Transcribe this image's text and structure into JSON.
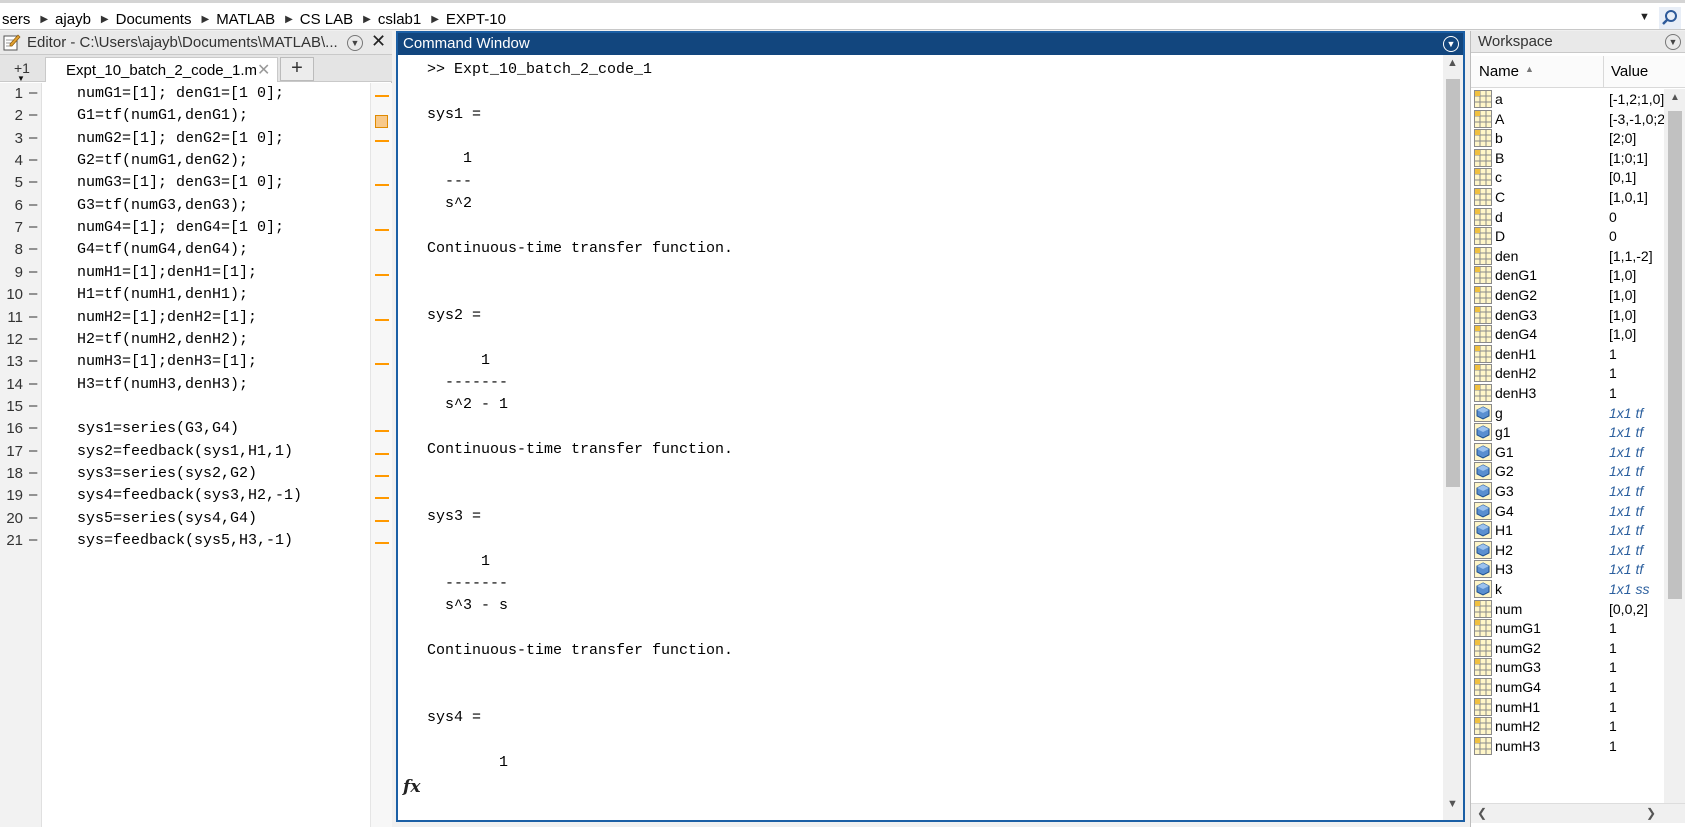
{
  "address_bar": {
    "crumbs": [
      "sers",
      "ajayb",
      "Documents",
      "MATLAB",
      "CS LAB",
      "cslab1",
      "EXPT-10"
    ]
  },
  "editor": {
    "title": "Editor - C:\\Users\\ajayb\\Documents\\MATLAB\\...",
    "split_label": "+1",
    "tab_label": "Expt_10_batch_2_code_1.m",
    "new_tab_symbol": "+",
    "lines": [
      {
        "n": "1",
        "text": "numG1=[1]; denG1=[1 0];",
        "warn": true
      },
      {
        "n": "2",
        "text": "G1=tf(numG1,denG1);",
        "warn": false
      },
      {
        "n": "3",
        "text": "numG2=[1]; denG2=[1 0];",
        "warn": true
      },
      {
        "n": "4",
        "text": "G2=tf(numG1,denG2);",
        "warn": false
      },
      {
        "n": "5",
        "text": "numG3=[1]; denG3=[1 0];",
        "warn": true
      },
      {
        "n": "6",
        "text": "G3=tf(numG3,denG3);",
        "warn": false
      },
      {
        "n": "7",
        "text": "numG4=[1]; denG4=[1 0];",
        "warn": true
      },
      {
        "n": "8",
        "text": "G4=tf(numG4,denG4);",
        "warn": false
      },
      {
        "n": "9",
        "text": "numH1=[1];denH1=[1];",
        "warn": true
      },
      {
        "n": "10",
        "text": "H1=tf(numH1,denH1);",
        "warn": false
      },
      {
        "n": "11",
        "text": "numH2=[1];denH2=[1];",
        "warn": true
      },
      {
        "n": "12",
        "text": "H2=tf(numH2,denH2);",
        "warn": false
      },
      {
        "n": "13",
        "text": "numH3=[1];denH3=[1];",
        "warn": true
      },
      {
        "n": "14",
        "text": "H3=tf(numH3,denH3);",
        "warn": false
      },
      {
        "n": "15",
        "text": "",
        "warn": false
      },
      {
        "n": "16",
        "text": "sys1=series(G3,G4)",
        "warn": true
      },
      {
        "n": "17",
        "text": "sys2=feedback(sys1,H1,1)",
        "warn": true
      },
      {
        "n": "18",
        "text": "sys3=series(sys2,G2)",
        "warn": true
      },
      {
        "n": "19",
        "text": "sys4=feedback(sys3,H2,-1)",
        "warn": true
      },
      {
        "n": "20",
        "text": "sys5=series(sys4,G4)",
        "warn": true
      },
      {
        "n": "21",
        "text": "sys=feedback(sys5,H3,-1)",
        "warn": true
      }
    ]
  },
  "command_window": {
    "title": "Command Window",
    "prompt_symbol": "fx",
    "output": [
      ">> Expt_10_batch_2_code_1",
      "",
      "sys1 =",
      "",
      "    1",
      "  ---",
      "  s^2",
      "",
      "Continuous-time transfer function.",
      "",
      "",
      "sys2 =",
      "",
      "      1",
      "  -------",
      "  s^2 - 1",
      "",
      "Continuous-time transfer function.",
      "",
      "",
      "sys3 =",
      "",
      "      1",
      "  -------",
      "  s^3 - s",
      "",
      "Continuous-time transfer function.",
      "",
      "",
      "sys4 =",
      "",
      "        1"
    ]
  },
  "workspace": {
    "title": "Workspace",
    "col_name": "Name",
    "col_value": "Value",
    "rows": [
      {
        "name": "a",
        "value": "[-1,2;1,0]",
        "type": "matrix"
      },
      {
        "name": "A",
        "value": "[-3,-1,0;2,",
        "type": "matrix"
      },
      {
        "name": "b",
        "value": "[2;0]",
        "type": "matrix"
      },
      {
        "name": "B",
        "value": "[1;0;1]",
        "type": "matrix"
      },
      {
        "name": "c",
        "value": "[0,1]",
        "type": "matrix"
      },
      {
        "name": "C",
        "value": "[1,0,1]",
        "type": "matrix"
      },
      {
        "name": "d",
        "value": "0",
        "type": "matrix"
      },
      {
        "name": "D",
        "value": "0",
        "type": "matrix"
      },
      {
        "name": "den",
        "value": "[1,1,-2]",
        "type": "matrix"
      },
      {
        "name": "denG1",
        "value": "[1,0]",
        "type": "matrix"
      },
      {
        "name": "denG2",
        "value": "[1,0]",
        "type": "matrix"
      },
      {
        "name": "denG3",
        "value": "[1,0]",
        "type": "matrix"
      },
      {
        "name": "denG4",
        "value": "[1,0]",
        "type": "matrix"
      },
      {
        "name": "denH1",
        "value": "1",
        "type": "matrix"
      },
      {
        "name": "denH2",
        "value": "1",
        "type": "matrix"
      },
      {
        "name": "denH3",
        "value": "1",
        "type": "matrix"
      },
      {
        "name": "g",
        "value": "1x1 tf",
        "type": "object"
      },
      {
        "name": "g1",
        "value": "1x1 tf",
        "type": "object"
      },
      {
        "name": "G1",
        "value": "1x1 tf",
        "type": "object"
      },
      {
        "name": "G2",
        "value": "1x1 tf",
        "type": "object"
      },
      {
        "name": "G3",
        "value": "1x1 tf",
        "type": "object"
      },
      {
        "name": "G4",
        "value": "1x1 tf",
        "type": "object"
      },
      {
        "name": "H1",
        "value": "1x1 tf",
        "type": "object"
      },
      {
        "name": "H2",
        "value": "1x1 tf",
        "type": "object"
      },
      {
        "name": "H3",
        "value": "1x1 tf",
        "type": "object"
      },
      {
        "name": "k",
        "value": "1x1 ss",
        "type": "object"
      },
      {
        "name": "num",
        "value": "[0,0,2]",
        "type": "matrix"
      },
      {
        "name": "numG1",
        "value": "1",
        "type": "matrix"
      },
      {
        "name": "numG2",
        "value": "1",
        "type": "matrix"
      },
      {
        "name": "numG3",
        "value": "1",
        "type": "matrix"
      },
      {
        "name": "numG4",
        "value": "1",
        "type": "matrix"
      },
      {
        "name": "numH1",
        "value": "1",
        "type": "matrix"
      },
      {
        "name": "numH2",
        "value": "1",
        "type": "matrix"
      },
      {
        "name": "numH3",
        "value": "1",
        "type": "matrix"
      }
    ]
  },
  "icons": {
    "matrix": "variable-matrix-icon",
    "object": "variable-object-icon",
    "editor": "editor-pencil-icon",
    "search": "search-icon"
  },
  "colors": {
    "title_active": "#12467e",
    "object_value": "#2b5f9e",
    "warning_marker": "#ff9900"
  }
}
